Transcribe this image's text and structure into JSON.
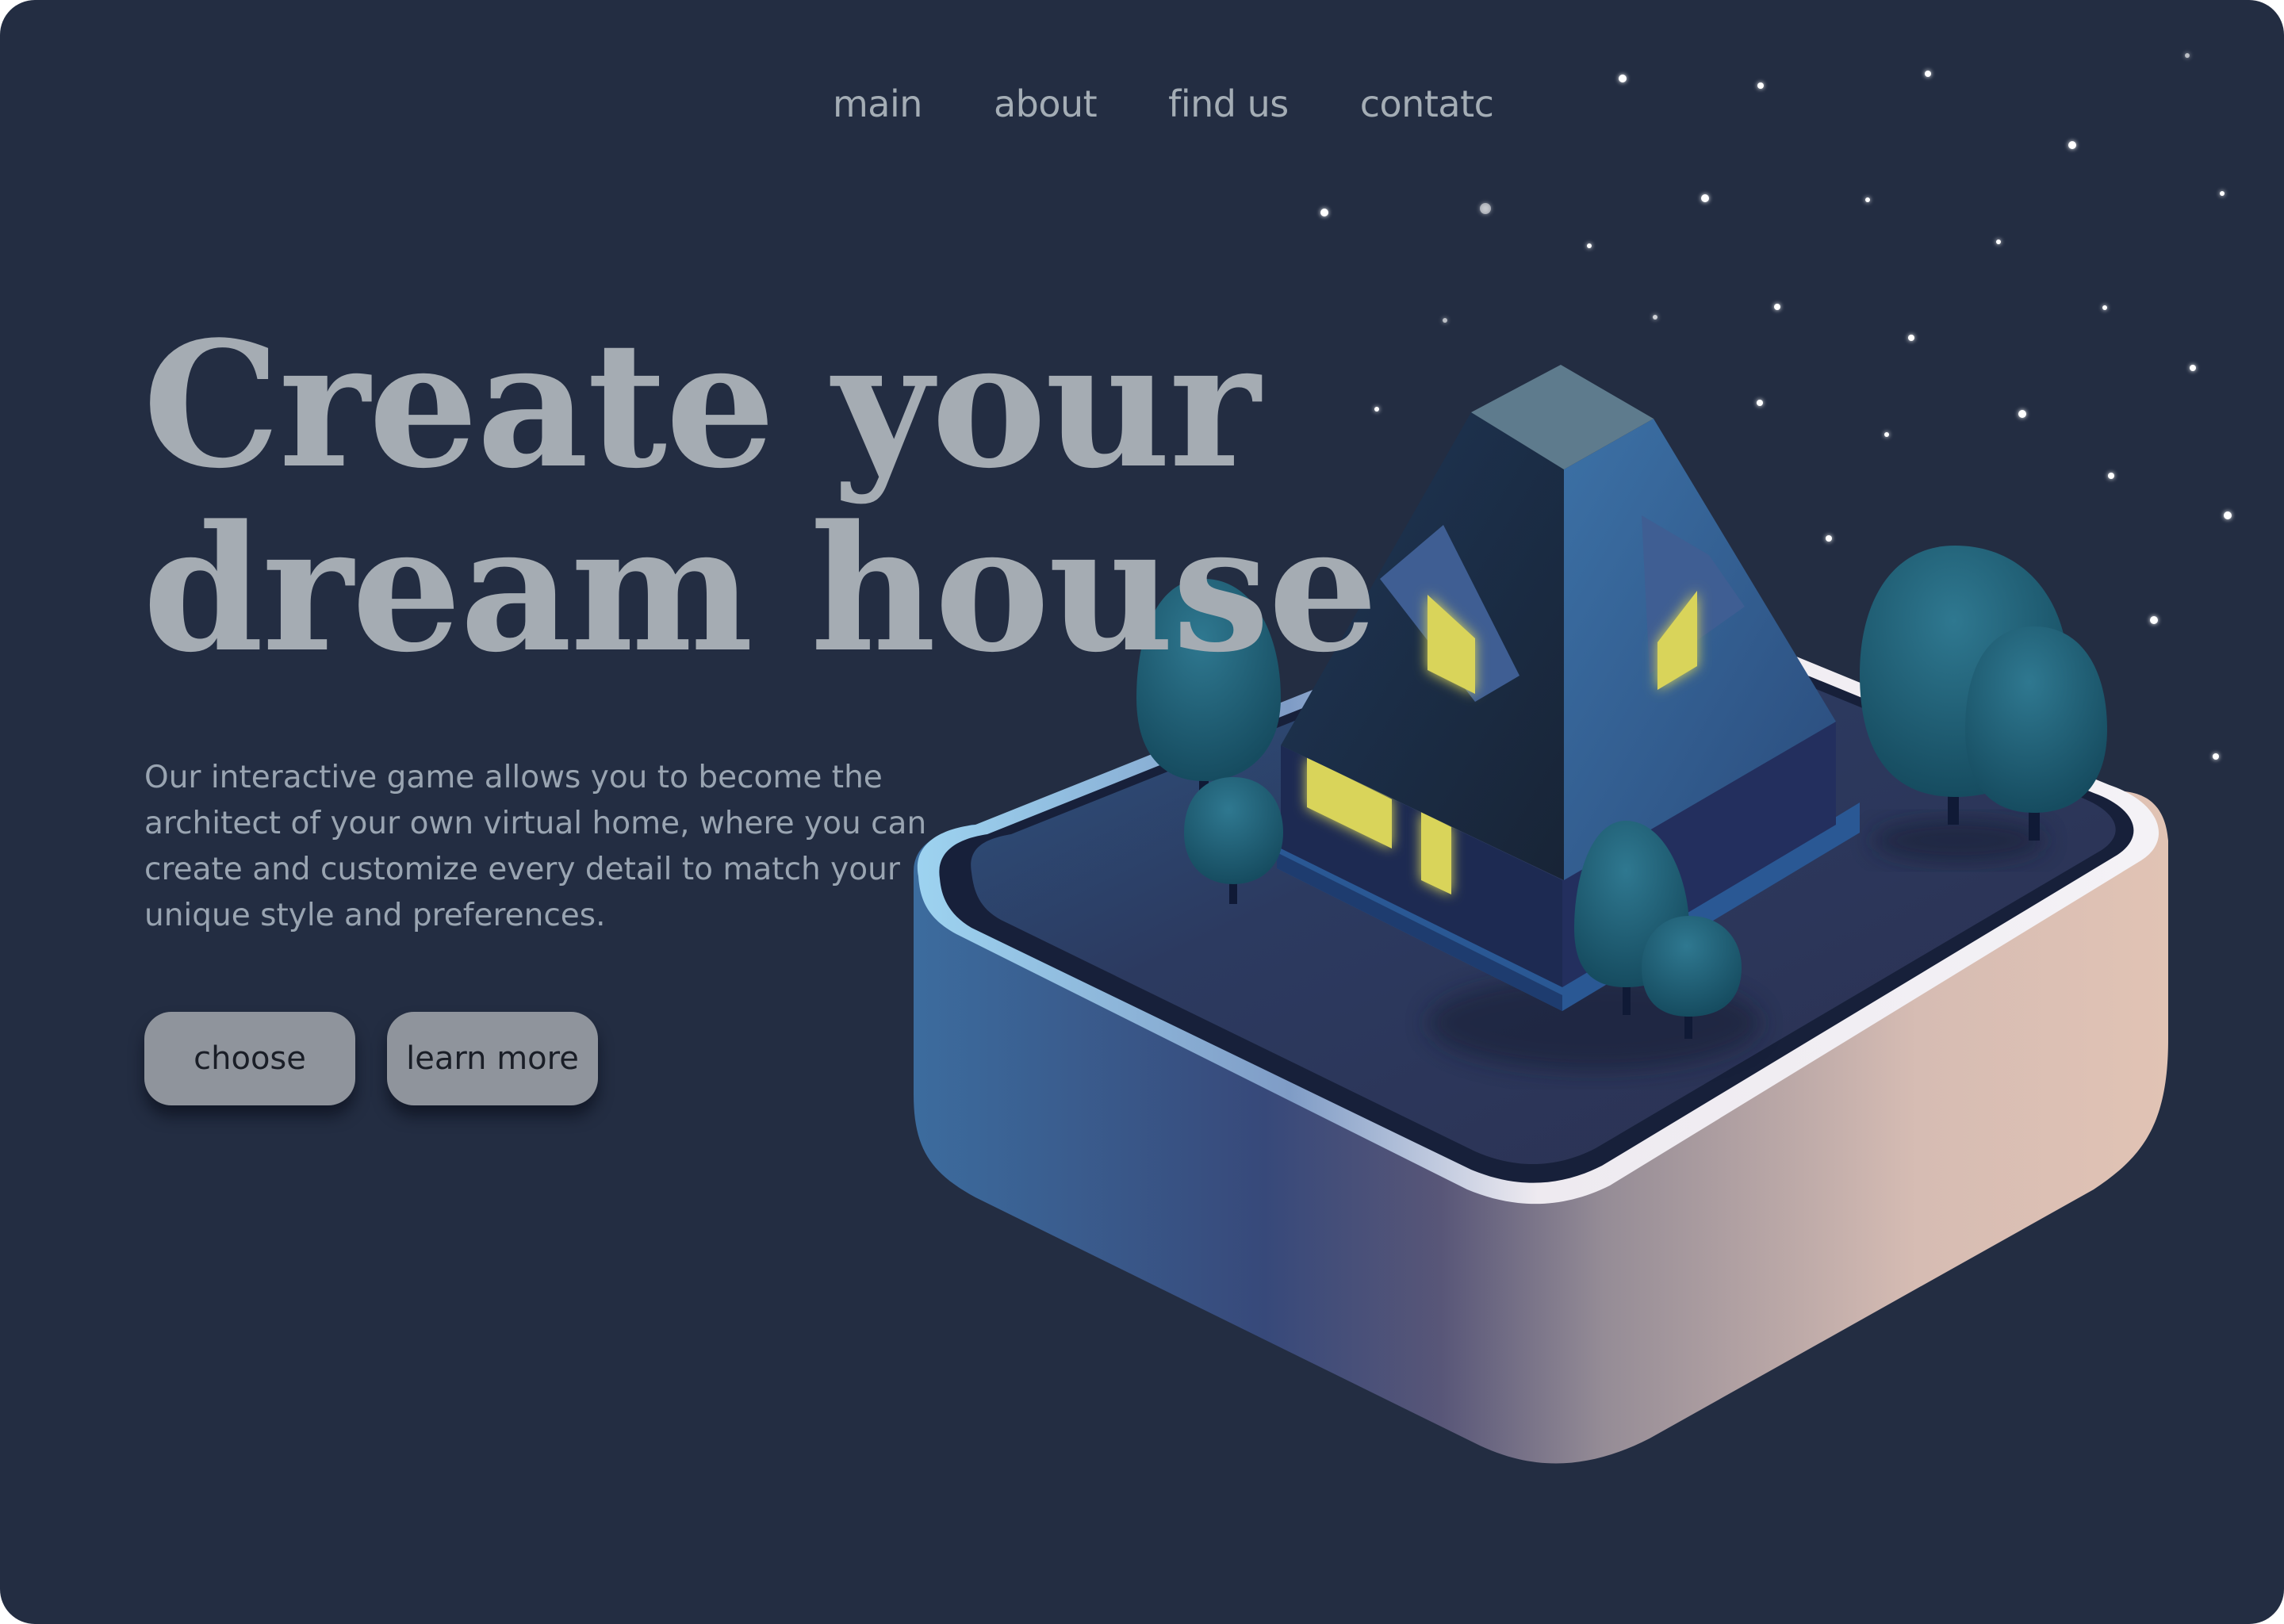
{
  "nav": {
    "items": [
      {
        "label": "main"
      },
      {
        "label": "about"
      },
      {
        "label": "find us"
      },
      {
        "label": "contatc"
      }
    ]
  },
  "hero": {
    "title_line1": "Create your",
    "title_line2": "dream house",
    "description": "Our interactive game allows you to become the architect of your own virtual home, where you can create and customize every detail to match your unique style and preferences.",
    "buttons": {
      "choose": "choose",
      "learn_more": "learn more"
    }
  },
  "colors": {
    "background": "#232d42",
    "title": "#a5acb3",
    "text": "#99a4b1",
    "button": "#8f949c",
    "window_light": "#d9d45a"
  },
  "icons": {
    "stars": "star-icon",
    "house": "house-illustration",
    "trees": "tree-icon"
  }
}
